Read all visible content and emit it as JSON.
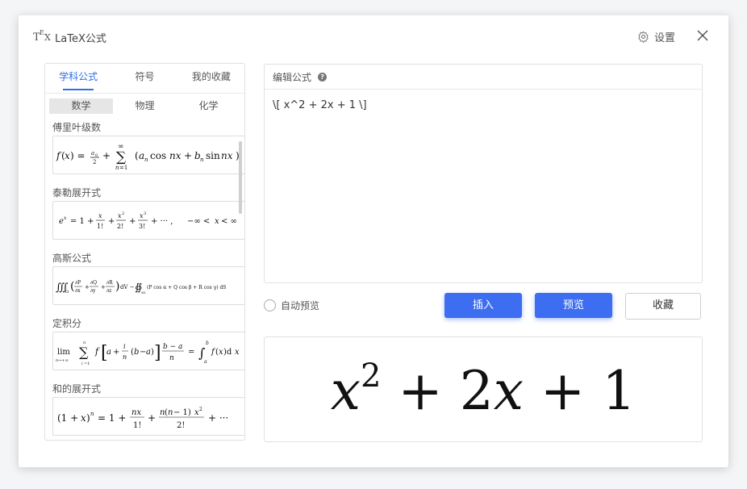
{
  "window": {
    "title": "LaTeX公式",
    "settings_label": "设置"
  },
  "tabs": [
    "学科公式",
    "符号",
    "我的收藏"
  ],
  "subtabs": [
    "数学",
    "物理",
    "化学"
  ],
  "formulas": [
    {
      "title": "傅里叶级数"
    },
    {
      "title": "泰勒展开式"
    },
    {
      "title": "高斯公式"
    },
    {
      "title": "定积分"
    },
    {
      "title": "和的展开式"
    }
  ],
  "editor": {
    "label": "编辑公式",
    "help": "?",
    "content": "\\[ x^2 + 2x + 1 \\]"
  },
  "controls": {
    "auto_preview": "自动预览",
    "insert": "插入",
    "preview": "预览",
    "favorite": "收藏"
  },
  "preview": {
    "rendered": "x² + 2x + 1"
  },
  "colors": {
    "accent": "#3d6df0",
    "tab_active": "#2f6fe4"
  },
  "icons": {
    "logo": "latex-logo-icon",
    "settings": "gear-icon",
    "close": "close-icon"
  }
}
